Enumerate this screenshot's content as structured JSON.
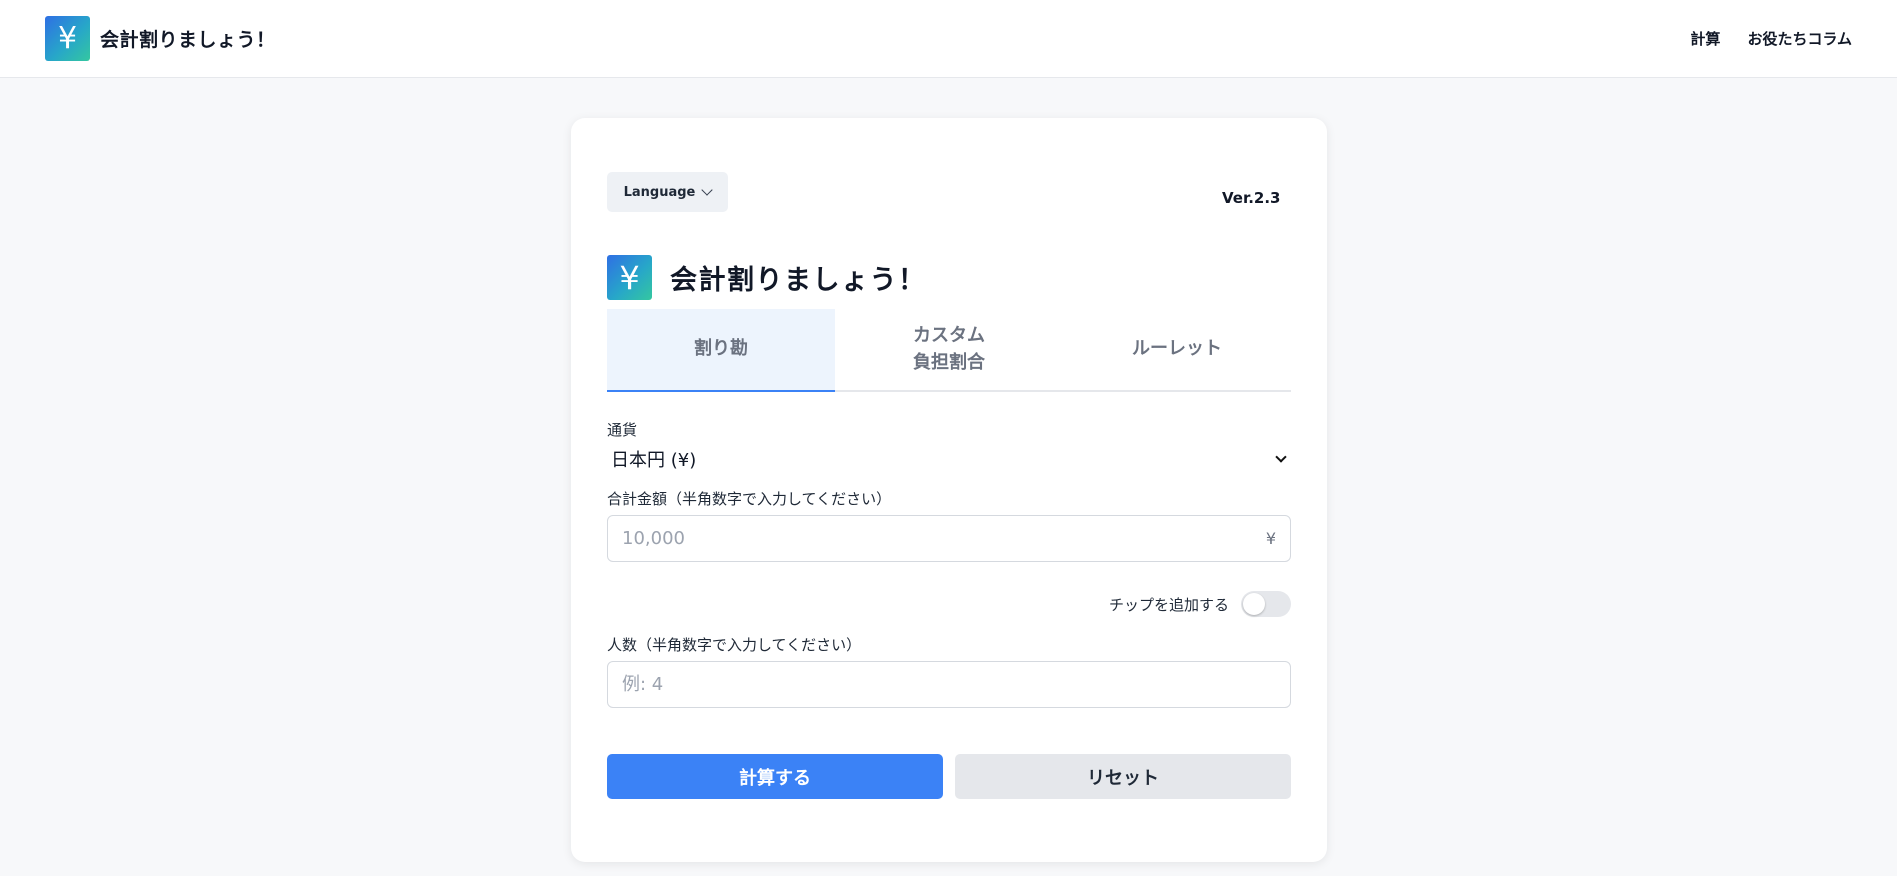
{
  "header": {
    "logo_glyph": "¥",
    "title": "会計割りましょう！",
    "nav": [
      {
        "label": "計算"
      },
      {
        "label": "お役たちコラム"
      }
    ]
  },
  "card": {
    "language_button": "Language",
    "version": "Ver.2.3",
    "logo_glyph": "¥",
    "title": "会計割りましょう！",
    "tabs": [
      {
        "label": "割り勘",
        "active": true
      },
      {
        "label": "カスタム\n負担割合",
        "active": false
      },
      {
        "label": "ルーレット",
        "active": false
      }
    ],
    "currency": {
      "label": "通貨",
      "selected": "日本円 (¥)"
    },
    "total": {
      "label": "合計金額（半角数字で入力してください）",
      "placeholder": "10,000",
      "value": "",
      "suffix": "¥"
    },
    "tip": {
      "label": "チップを追加する",
      "enabled": false
    },
    "people": {
      "label": "人数（半角数字で入力してください）",
      "placeholder": "例: 4",
      "value": ""
    },
    "buttons": {
      "calculate": "計算する",
      "reset": "リセット"
    }
  },
  "colors": {
    "accent": "#3b82f6",
    "active_tab_bg": "#edf4fd",
    "page_bg": "#f7f8fa"
  }
}
